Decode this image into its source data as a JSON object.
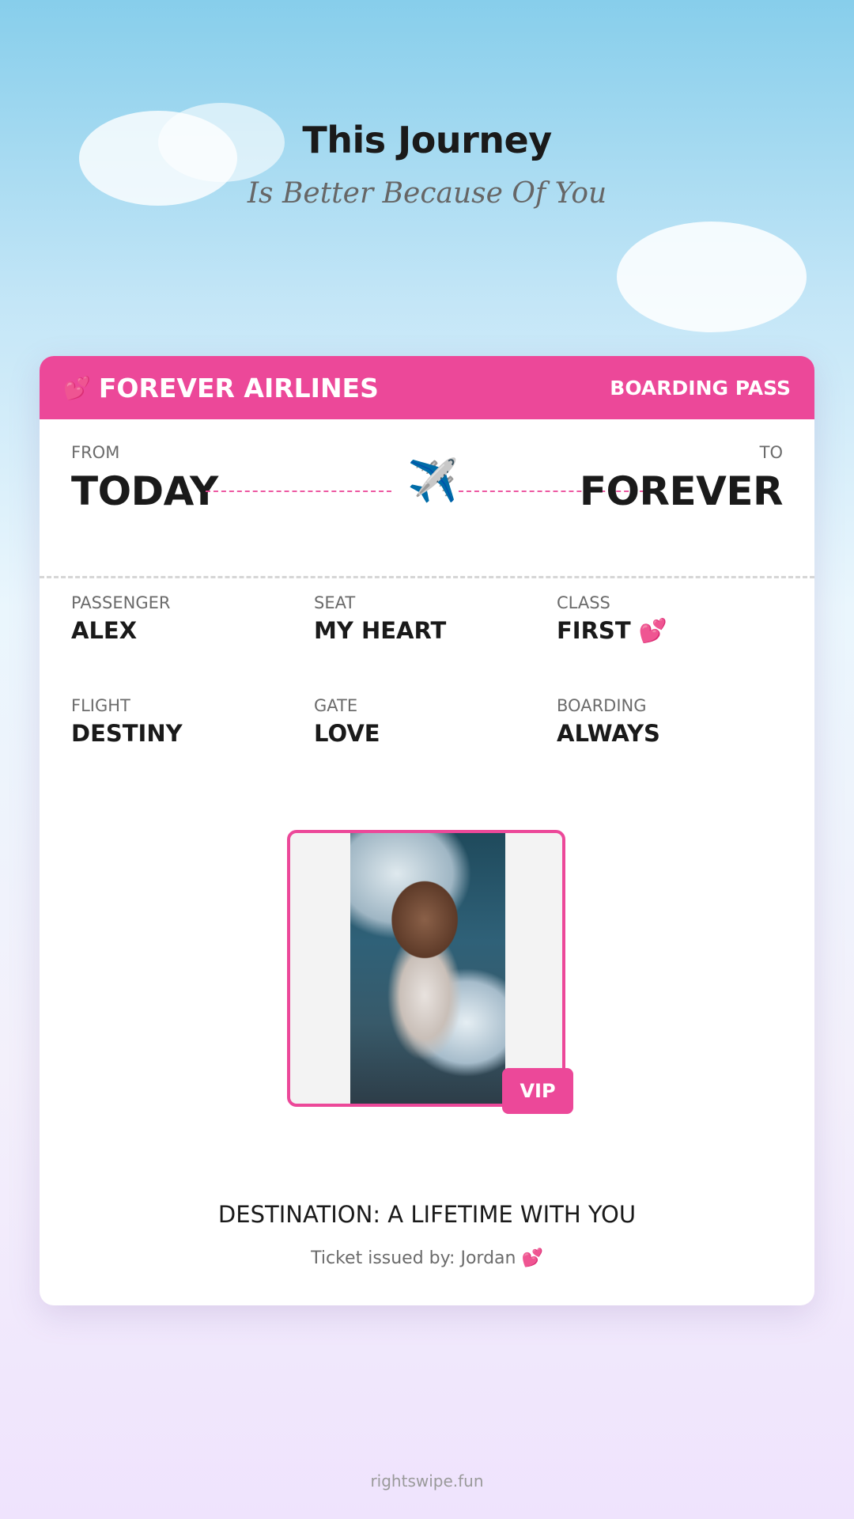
{
  "hero": {
    "title": "This Journey",
    "subtitle": "Is Better Because Of You"
  },
  "ticket": {
    "airline_icon": "💕",
    "airline_name": "FOREVER AIRLINES",
    "pass_label": "BOARDING PASS",
    "from_label": "FROM",
    "from_value": "TODAY",
    "to_label": "TO",
    "to_value": "FOREVER",
    "plane_icon": "✈️",
    "details": {
      "passenger": {
        "label": "PASSENGER",
        "value": "ALEX"
      },
      "seat": {
        "label": "SEAT",
        "value": "MY HEART"
      },
      "class": {
        "label": "CLASS",
        "value": "FIRST 💕"
      },
      "flight": {
        "label": "FLIGHT",
        "value": "DESTINY"
      },
      "gate": {
        "label": "GATE",
        "value": "LOVE"
      },
      "boarding": {
        "label": "BOARDING",
        "value": "ALWAYS"
      }
    },
    "vip_badge": "VIP",
    "destination": "DESTINATION: A LIFETIME WITH YOU",
    "issued_by": "Ticket issued by: Jordan 💕"
  },
  "footer": {
    "site": "rightswipe.fun"
  },
  "colors": {
    "accent": "#ec4899",
    "sky_top": "#87ceeb",
    "bottom_lavender": "#efe3fd"
  }
}
